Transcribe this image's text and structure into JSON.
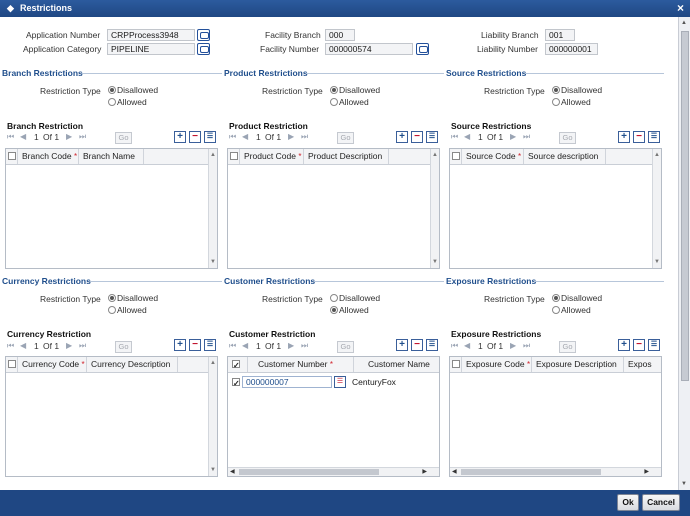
{
  "window": {
    "title": "Restrictions",
    "close": "×"
  },
  "header": {
    "application_number_label": "Application Number",
    "application_number": "CRPProcess3948",
    "application_category_label": "Application Category",
    "application_category": "PIPELINE",
    "facility_branch_label": "Facility Branch",
    "facility_branch": "000",
    "facility_number_label": "Facility Number",
    "facility_number": "000000574",
    "liability_branch_label": "Liability Branch",
    "liability_branch": "001",
    "liability_number_label": "Liability Number",
    "liability_number": "000000001"
  },
  "common": {
    "restriction_type_label": "Restriction Type",
    "disallowed": "Disallowed",
    "allowed": "Allowed",
    "first": "⏮",
    "prev": "◀",
    "page": "1",
    "of": "Of 1",
    "next": "▶",
    "last": "⏭",
    "go": "Go",
    "add": "+",
    "delete": "−",
    "list": "☰",
    "required": "*"
  },
  "branch": {
    "section": "Branch Restrictions",
    "grid_title": "Branch Restriction",
    "restriction_type": "Disallowed",
    "col1": "Branch Code",
    "col2": "Branch Name"
  },
  "product": {
    "section": "Product Restrictions",
    "grid_title": "Product Restriction",
    "restriction_type": "Disallowed",
    "col1": "Product Code",
    "col2": "Product Description"
  },
  "source": {
    "section": "Source Restrictions",
    "grid_title": "Source Restrictions",
    "restriction_type": "Disallowed",
    "col1": "Source Code",
    "col2": "Source description"
  },
  "currency": {
    "section": "Currency Restrictions",
    "grid_title": "Currency Restriction",
    "restriction_type": "Disallowed",
    "col1": "Currency Code",
    "col2": "Currency Description"
  },
  "customer": {
    "section": "Customer Restrictions",
    "grid_title": "Customer Restriction",
    "restriction_type": "Allowed",
    "col1": "Customer Number",
    "col2": "Customer Name",
    "rows": [
      {
        "selected": true,
        "customer_number": "000000007",
        "customer_name": "CenturyFox"
      }
    ]
  },
  "exposure": {
    "section": "Exposure Restrictions",
    "grid_title": "Exposure Restrictions",
    "restriction_type": "Disallowed",
    "col1": "Exposure Code",
    "col2": "Exposure Description",
    "col3": "Expos"
  },
  "footer": {
    "ok": "Ok",
    "cancel": "Cancel"
  },
  "colors": {
    "titlebar": "#1f4783",
    "section_text": "#1f4e8c",
    "delete_red": "#c0102a"
  }
}
